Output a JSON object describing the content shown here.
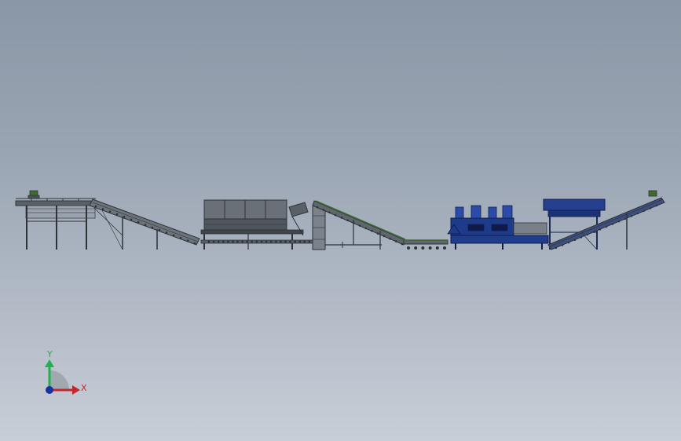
{
  "viewport": {
    "background_top": "#8a97a6",
    "background_bottom": "#c8ced7"
  },
  "triad": {
    "y_label": "Y",
    "x_label": "X",
    "y_color": "#22b14c",
    "x_color": "#c0282d",
    "z_color": "#1f2f9e"
  },
  "colors": {
    "steel_dark": "#2e3338",
    "steel_mid": "#4a5057",
    "steel_light": "#8c9299",
    "blue_equipment": "#1e3a8a",
    "green_belt": "#3f6b2f"
  }
}
